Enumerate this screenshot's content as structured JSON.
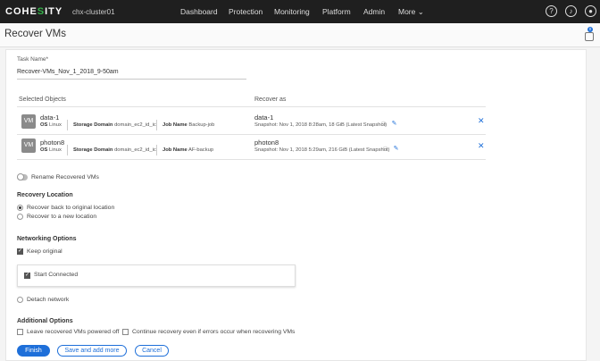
{
  "nav": {
    "logo_text": "COHE",
    "logo_dot": "S",
    "logo_rest": "ITY",
    "cluster": "chx-cluster01",
    "items": [
      "Dashboard",
      "Protection",
      "Monitoring",
      "Platform",
      "Admin"
    ],
    "more": "More",
    "icons": [
      "help-icon",
      "bell-icon",
      "user-icon"
    ]
  },
  "page": {
    "title": "Recover VMs",
    "notification_count": "0"
  },
  "task": {
    "label": "Task Name*",
    "value": "Recover-VMs_Nov_1_2018_9-50am"
  },
  "columns": {
    "selected": "Selected Objects",
    "recover_as": "Recover as"
  },
  "objects": [
    {
      "badge": "VM",
      "name": "data-1",
      "os_label": "OS",
      "os": "Linux",
      "sd_label": "Storage Domain",
      "sd": "domain_ec2_id_ic",
      "job_label": "Job Name",
      "job": "Backup-job",
      "recover_name": "data-1",
      "snapshot": "Snapshot: Nov 1, 2018 8:28am, 18 GiB (Latest Snapshot)"
    },
    {
      "badge": "VM",
      "name": "photon8",
      "os_label": "OS",
      "os": "Linux",
      "sd_label": "Storage Domain",
      "sd": "domain_ec2_id_ic",
      "job_label": "Job Name",
      "job": "AF-backup",
      "recover_name": "photon8",
      "snapshot": "Snapshot: Nov 1, 2018 5:29am, 216 GiB (Latest Snapshot)"
    }
  ],
  "rename": {
    "label": "Rename Recovered VMs"
  },
  "recovery_location": {
    "heading": "Recovery Location",
    "options": [
      "Recover back to original location",
      "Recover to a new location"
    ],
    "selected_index": 0
  },
  "networking": {
    "heading": "Networking Options",
    "keep_original": "Keep original",
    "start_connected": "Start Connected",
    "detach": "Detach network"
  },
  "additional": {
    "heading": "Additional Options",
    "leave_off": "Leave recovered VMs powered off",
    "continue_recovery": "Continue recovery even if errors occur when recovering VMs"
  },
  "buttons": {
    "finish": "Finish",
    "save_add": "Save and add more",
    "cancel": "Cancel"
  },
  "colors": {
    "accent": "#1e6fd9",
    "brand_green": "#35b34a",
    "nav_bg": "#1f1f1f"
  }
}
